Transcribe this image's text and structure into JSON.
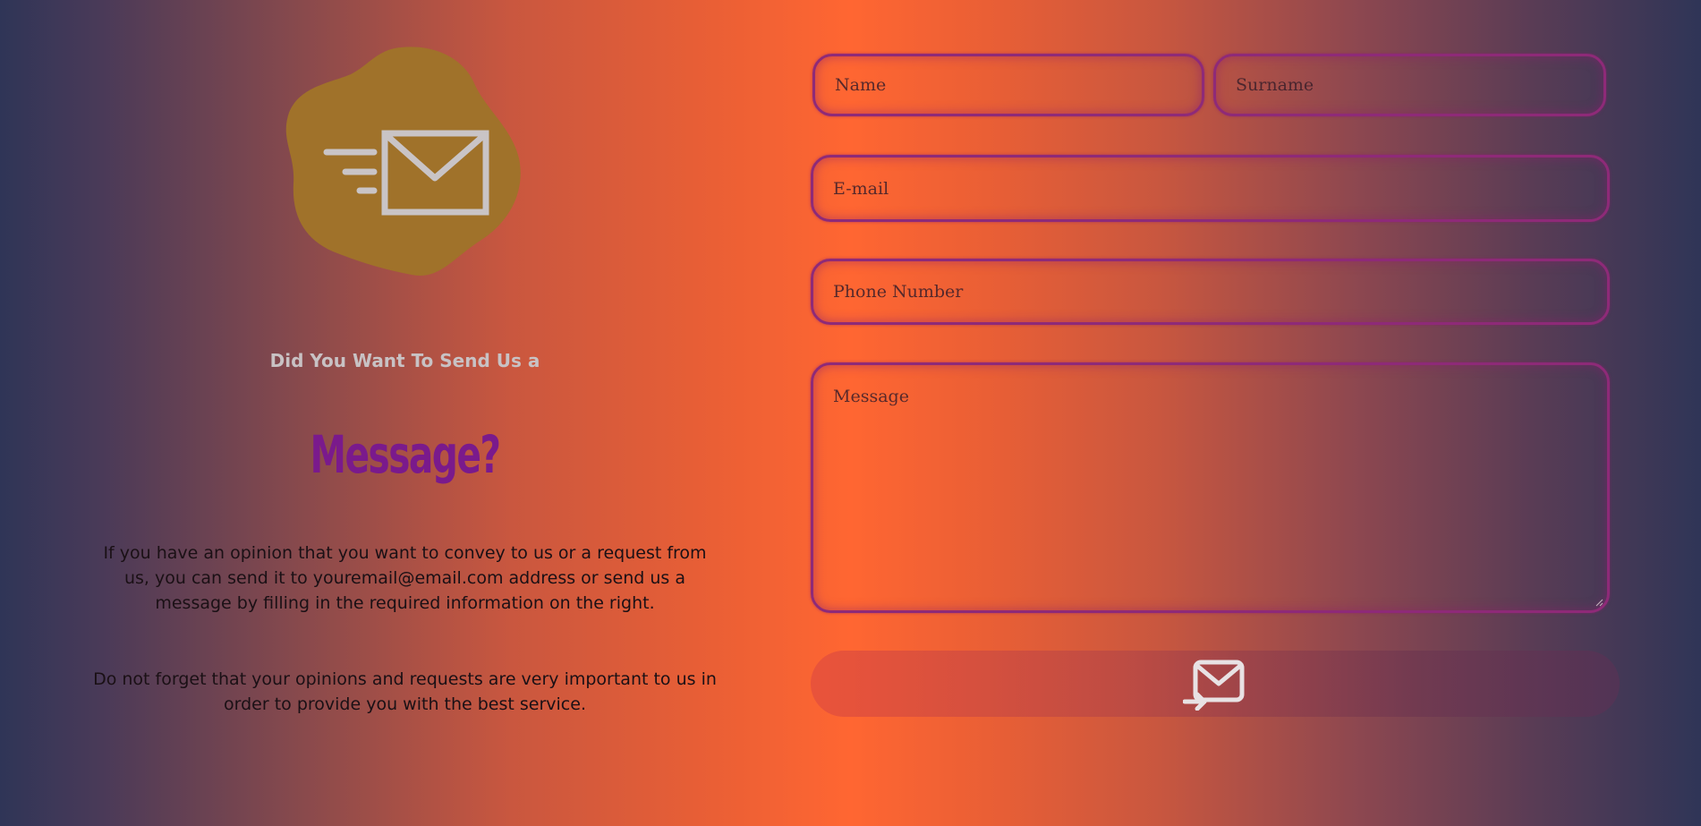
{
  "hero": {
    "subtitle": "Did You Want To Send Us a",
    "headline": "Message?",
    "paragraph_1": "If you have an opinion that you want to convey to us or a request from us, you can send it to youremail@email.com address or send us a message by filling in the required information on the right.",
    "paragraph_2": "Do not forget that your opinions and requests are very important to us in order to provide you with the best service.",
    "illustration_icon": "mail-fast-icon"
  },
  "form": {
    "name_placeholder": "Name",
    "surname_placeholder": "Surname",
    "email_placeholder": "E-mail",
    "phone_placeholder": "Phone Number",
    "message_placeholder": "Message",
    "submit_icon": "mail-send-icon"
  },
  "colors": {
    "headline": "#7a1a8c",
    "subtitle": "#c8c2c4",
    "blob": "#a0722a",
    "icon_stroke": "#c9c4c6",
    "field_border": "#8e2a78",
    "center_gradient": "#ff6632",
    "edge_gradient": "#2f3557"
  }
}
